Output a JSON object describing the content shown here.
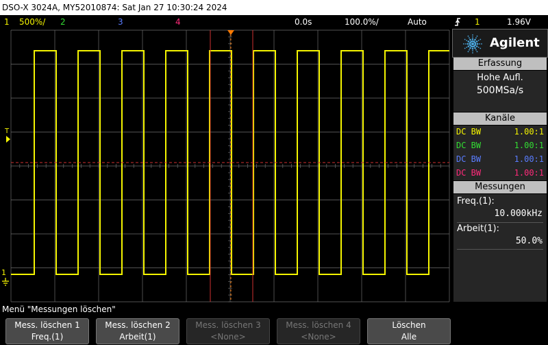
{
  "window": {
    "title": "DSO-X 3024A, MY52010874: Sat Jan 27 10:30:24 2024"
  },
  "status": {
    "ch1_num": "1",
    "ch1_scale": "500%/",
    "ch2_num": "2",
    "ch3_num": "3",
    "ch4_num": "4",
    "time_delay": "0.0s",
    "time_scale": "100.0%/",
    "trigger_mode": "Auto",
    "trigger_icon": "rising-edge-icon",
    "trigger_source": "1",
    "trigger_level": "1.96V"
  },
  "screen": {
    "trigger_marker": "T",
    "ch1_marker": "1",
    "ground_icon": "ground-icon",
    "waveform": {
      "channel": 1,
      "frequency_khz": 10.0,
      "duty_percent": 50.0
    }
  },
  "side": {
    "brand": "Agilent",
    "acquisition": {
      "title": "Erfassung",
      "mode": "Hohe Aufl.",
      "rate": "500MSa/s"
    },
    "channels": {
      "title": "Kanäle",
      "rows": [
        {
          "coupling": "DC BW",
          "probe": "1.00:1",
          "color": "#f5f500"
        },
        {
          "coupling": "DC BW",
          "probe": "1.00:1",
          "color": "#33dd33"
        },
        {
          "coupling": "DC BW",
          "probe": "1.00:1",
          "color": "#5a7dff"
        },
        {
          "coupling": "DC BW",
          "probe": "1.00:1",
          "color": "#ff2a7a"
        }
      ]
    },
    "measurements": {
      "title": "Messungen",
      "m1_label": "Freq.(1):",
      "m1_value": "10.000kHz",
      "m2_label": "Arbeit(1):",
      "m2_value": "50.0%"
    }
  },
  "menu": {
    "title": "Menü \"Messungen löschen\"",
    "keys": [
      {
        "l1": "Mess. löschen 1",
        "l2": "Freq.(1)",
        "enabled": true
      },
      {
        "l1": "Mess. löschen 2",
        "l2": "Arbeit(1)",
        "enabled": true
      },
      {
        "l1": "Mess. löschen 3",
        "l2": "<None>",
        "enabled": false
      },
      {
        "l1": "Mess. löschen 4",
        "l2": "<None>",
        "enabled": false
      },
      {
        "l1": "Löschen",
        "l2": "Alle",
        "enabled": true
      }
    ]
  },
  "colors": {
    "ch1": "#f5f500",
    "ch2": "#33dd33",
    "ch3": "#5a7dff",
    "ch4": "#ff2a7a",
    "trigger": "#ff7a00",
    "grid": "#6e6e6e",
    "marker_red": "#d03030"
  }
}
